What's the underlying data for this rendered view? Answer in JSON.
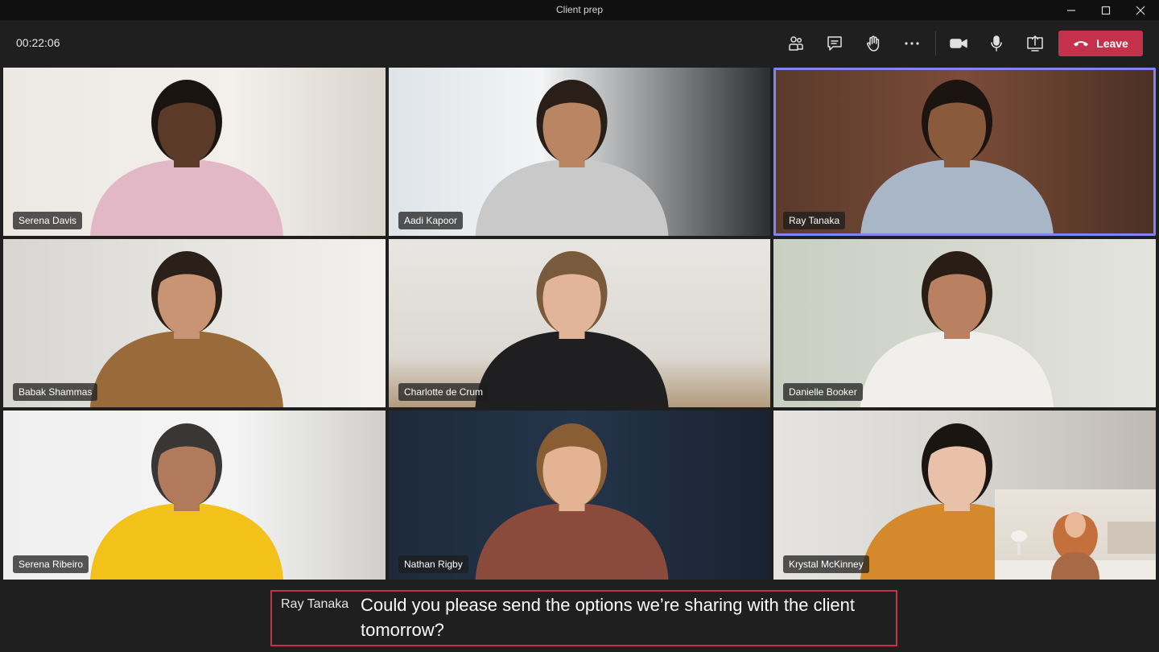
{
  "window": {
    "title": "Client prep"
  },
  "toolbar": {
    "timer": "00:22:06",
    "icons": [
      "people-icon",
      "chat-icon",
      "raise-hand-icon",
      "more-icon",
      "camera-icon",
      "microphone-icon",
      "share-screen-icon",
      "phone-icon"
    ],
    "leave_label": "Leave",
    "leave_color": "#c4314b"
  },
  "participants": [
    {
      "name": "Serena Davis"
    },
    {
      "name": "Aadi Kapoor"
    },
    {
      "name": "Ray Tanaka",
      "speaking": true
    },
    {
      "name": "Babak Shammas"
    },
    {
      "name": "Charlotte de Crum"
    },
    {
      "name": "Danielle Booker"
    },
    {
      "name": "Serena Ribeiro"
    },
    {
      "name": "Nathan Rigby"
    },
    {
      "name": "Krystal McKinney"
    }
  ],
  "speaking_border_color": "#7f85f5",
  "caption": {
    "speaker": "Ray Tanaka",
    "text": "Could you please send the options we’re sharing with the client tomorrow?"
  }
}
